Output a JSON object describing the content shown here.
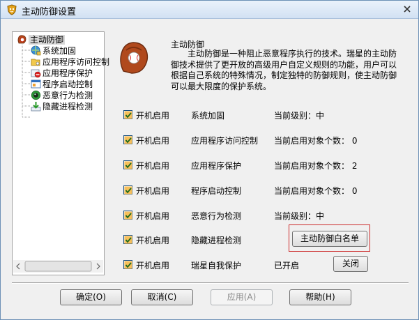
{
  "window": {
    "title": "主动防御设置",
    "close_glyph": "×"
  },
  "tree": {
    "root": {
      "label": "主动防御",
      "icon": "glove-icon"
    },
    "items": [
      {
        "label": "系统加固",
        "icon": "globe-shield-icon"
      },
      {
        "label": "应用程序访问控制",
        "icon": "folder-key-icon"
      },
      {
        "label": "应用程序保护",
        "icon": "no-entry-icon"
      },
      {
        "label": "程序启动控制",
        "icon": "window-app-icon"
      },
      {
        "label": "恶意行为检测",
        "icon": "green-globe-icon"
      },
      {
        "label": "隐藏进程检测",
        "icon": "download-arrow-icon"
      }
    ]
  },
  "content": {
    "title": "主动防御",
    "description": "主动防御是一种阻止恶意程序执行的技术。瑞星的主动防御技术提供了更开放的高级用户自定义规则的功能，用户可以根据自己系统的特殊情况，制定独特的防御规则，使主动防御可以最大限度的保护系统。"
  },
  "rows": [
    {
      "checkbox_label": "开机启用",
      "checked": true,
      "name": "系统加固",
      "status": "当前级别：中"
    },
    {
      "checkbox_label": "开机启用",
      "checked": true,
      "name": "应用程序访问控制",
      "status": "当前启用对象个数： 0"
    },
    {
      "checkbox_label": "开机启用",
      "checked": true,
      "name": "应用程序保护",
      "status": "当前启用对象个数： 2"
    },
    {
      "checkbox_label": "开机启用",
      "checked": true,
      "name": "程序启动控制",
      "status": "当前启用对象个数： 0"
    },
    {
      "checkbox_label": "开机启用",
      "checked": true,
      "name": "恶意行为检测",
      "status": "当前级别：中"
    },
    {
      "checkbox_label": "开机启用",
      "checked": true,
      "name": "隐藏进程检测",
      "status": ""
    },
    {
      "checkbox_label": "开机启用",
      "checked": true,
      "name": "瑞星自我保护",
      "status": "已开启"
    }
  ],
  "buttons": {
    "whitelist": "主动防御白名单",
    "close_protect": "关闭",
    "ok": "确定(O)",
    "cancel": "取消(C)",
    "apply": "应用(A)",
    "help": "帮助(H)"
  },
  "colors": {
    "check_mark": "#1c9a1c",
    "checkbox_fill": "#f5a623",
    "highlight_frame": "#cc2a2a",
    "title_bar": "#d2e1f3"
  }
}
